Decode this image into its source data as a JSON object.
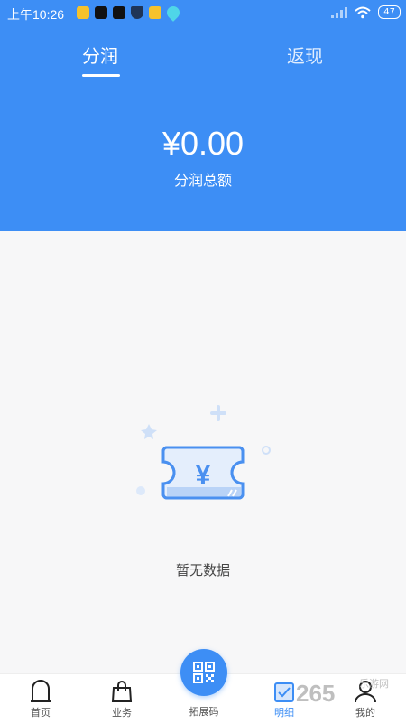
{
  "status_bar": {
    "time": "上午10:26",
    "battery": "47",
    "notif_icons": [
      "app-icon",
      "tiktok-icon",
      "tiktok-icon",
      "shield-icon",
      "app-icon",
      "drop-icon"
    ]
  },
  "tabs": [
    {
      "label": "分润",
      "active": true
    },
    {
      "label": "返现",
      "active": false
    }
  ],
  "summary": {
    "amount": "¥0.00",
    "label": "分润总额"
  },
  "empty_state": {
    "text": "暂无数据",
    "icon": "yen-ticket-icon"
  },
  "bottom_nav": {
    "items": [
      {
        "label": "首页",
        "icon": "home-icon"
      },
      {
        "label": "业务",
        "icon": "bag-icon"
      },
      {
        "label": "拓展码",
        "icon": "qr-code-icon"
      },
      {
        "label": "明细",
        "icon": "detail-icon",
        "active": true
      },
      {
        "label": "我的",
        "icon": "user-icon"
      }
    ]
  },
  "watermark": {
    "text": "265",
    "small": "乐游网"
  },
  "colors": {
    "primary": "#3d8ef5",
    "background": "#f7f7f8"
  }
}
